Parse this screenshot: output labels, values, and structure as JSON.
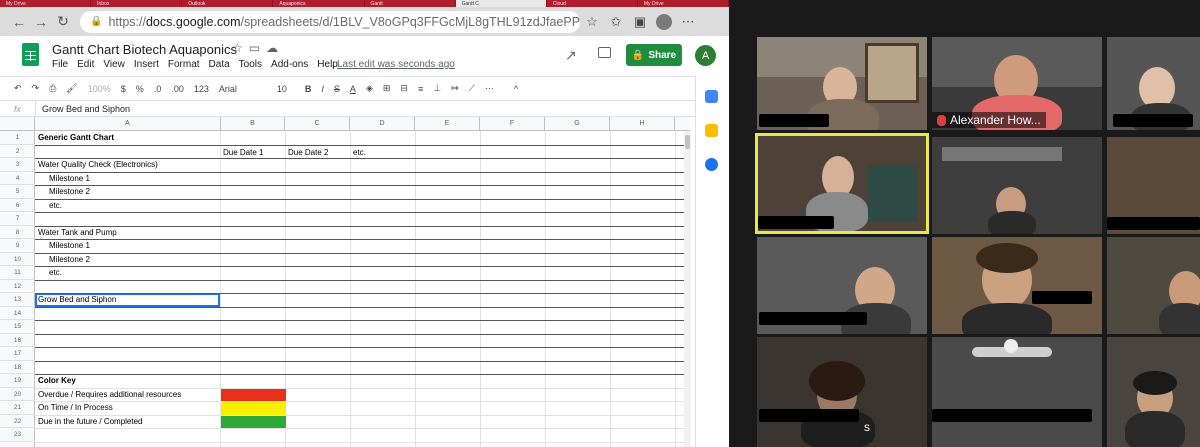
{
  "browser": {
    "url_prefix": "https://",
    "url_host": "docs.google.com",
    "url_path": "/spreadsheets/d/1BLV_V8oGPq3FFGcMjL8gTHL91zdJfaePPzDaRPZBzkk/e...",
    "tabs": [
      "My Drive",
      "Inbox",
      "Outlook",
      "Aquaponics",
      "Gantt",
      "Gantt C",
      "Cloud",
      "My Drive"
    ]
  },
  "sheets": {
    "title": "Gantt Chart Biotech Aquaponics",
    "menu": [
      "File",
      "Edit",
      "View",
      "Insert",
      "Format",
      "Data",
      "Tools",
      "Add-ons",
      "Help"
    ],
    "last_edit": "Last edit was seconds ago",
    "share_label": "Share",
    "user_initial": "A",
    "toolbar": {
      "zoom": "100%",
      "currency": "$",
      "percent": "%",
      "dec_less": ".0",
      "dec_more": ".00",
      "format_more": "123",
      "font": "Arial",
      "font_size": "10",
      "bold": "B",
      "italic": "I",
      "strike": "S",
      "text_color": "A"
    },
    "formula_fx": "fx",
    "formula_value": "Grow Bed and Siphon",
    "columns": [
      "A",
      "B",
      "C",
      "D",
      "E",
      "F",
      "G",
      "H"
    ],
    "rows": [
      "1",
      "2",
      "3",
      "4",
      "5",
      "6",
      "7",
      "8",
      "9",
      "10",
      "11",
      "12",
      "13",
      "14",
      "15",
      "16",
      "17",
      "18",
      "19",
      "20",
      "21",
      "22",
      "23"
    ],
    "cells": {
      "r1a": "Generic Gantt Chart",
      "r2b": "Due Date 1",
      "r2c": "Due Date 2",
      "r2d": "etc.",
      "r3a": "Water Quality Check (Electronics)",
      "r4a": "Milestone 1",
      "r5a": "Milestone 2",
      "r6a": "etc.",
      "r8a": "Water Tank and Pump",
      "r9a": "Milestone 1",
      "r10a": "Milestone 2",
      "r11a": "etc.",
      "r13a": "Grow Bed and Siphon",
      "r19a": "Color Key",
      "r20a": "Overdue / Requires additional resources",
      "r21a": "On Time / In Process",
      "r22a": "Due in the future / Completed"
    },
    "key_colors": {
      "overdue": "#e8301e",
      "on_time": "#f8f000",
      "future": "#2ea836"
    }
  },
  "zoom": {
    "participant_name": "Alexander How...",
    "partial_name": "s"
  }
}
